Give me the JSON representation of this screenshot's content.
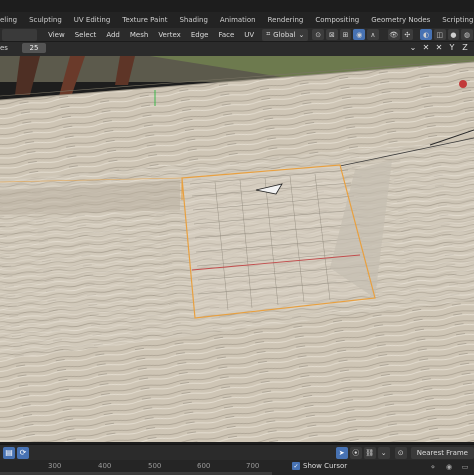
{
  "workspace_tabs": [
    "eling",
    "Sculpting",
    "UV Editing",
    "Texture Paint",
    "Shading",
    "Animation",
    "Rendering",
    "Compositing",
    "Geometry Nodes",
    "Scripting"
  ],
  "workspace_add": "+",
  "header": {
    "menus": [
      "View",
      "Select",
      "Add",
      "Mesh",
      "Vertex",
      "Edge",
      "Face",
      "UV"
    ],
    "transform_orientation": "Global"
  },
  "panel": {
    "frame_label": "es",
    "frame_value": "25"
  },
  "viewport_icons": [
    "chevron-icon",
    "x-icon",
    "x-icon",
    "y-icon",
    "z-icon"
  ],
  "bottom": {
    "snap_mode": "Nearest Frame"
  },
  "ruler": {
    "ticks": [
      "300",
      "400",
      "500",
      "600",
      "700"
    ],
    "show_cursor_label": "Show Cursor"
  },
  "colors": {
    "accent": "#4772b3",
    "selection_outline": "#e8a040",
    "ground": "#cfc6b7"
  }
}
